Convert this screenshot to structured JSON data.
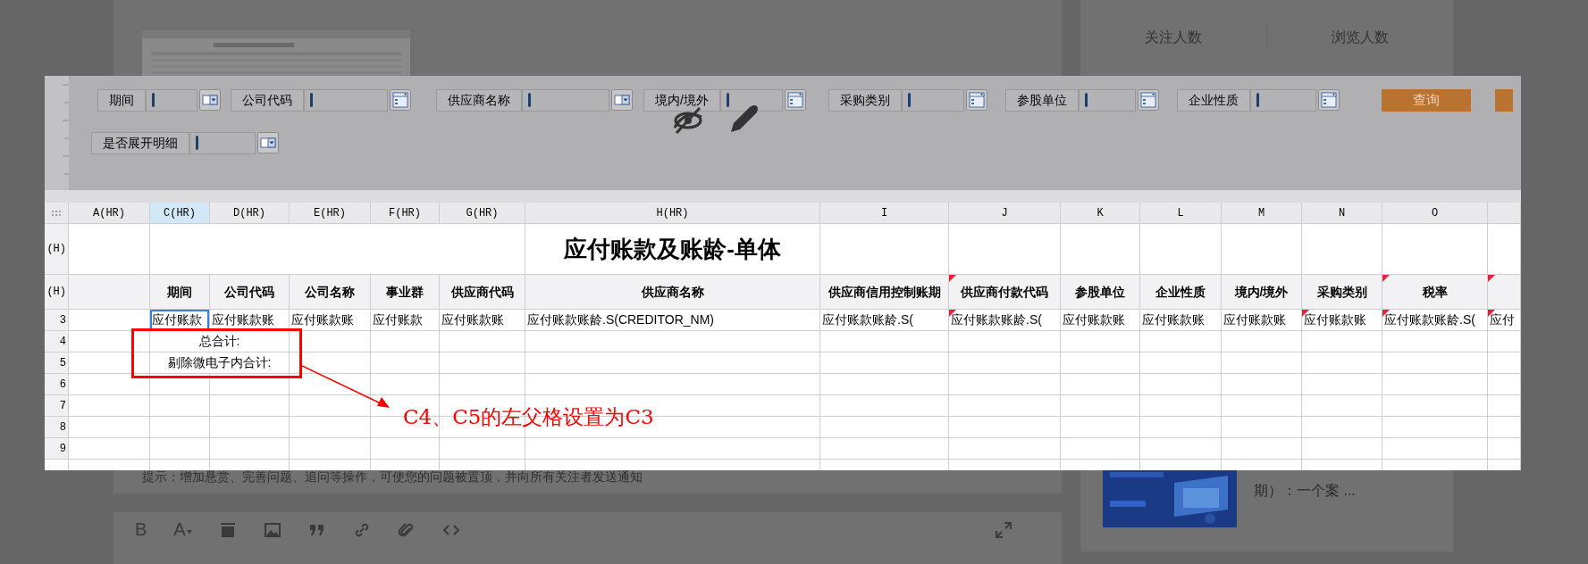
{
  "background_page": {
    "stats": [
      {
        "label": "关注人数"
      },
      {
        "label": "浏览人数"
      }
    ],
    "hint": "提示：增加悬赏、完善问题、追问等操作，可使您的问题被置顶，并向所有关注者发送通知",
    "editor_toolbar": {
      "bold_glyph": "B",
      "font_glyph": "A"
    },
    "side_article": {
      "title_fragment": "期）：一个案 ..."
    }
  },
  "image": {
    "filter_rows": [
      [
        {
          "label": "期间",
          "kind": "dropdown"
        },
        {
          "label": "公司代码",
          "kind": "list"
        },
        {
          "label": "供应商名称",
          "kind": "dropdown"
        },
        {
          "label": "境内/境外",
          "kind": "list"
        },
        {
          "label": "采购类别",
          "kind": "list"
        },
        {
          "label": "参股单位",
          "kind": "list"
        },
        {
          "label": "企业性质",
          "kind": "list"
        }
      ],
      [
        {
          "label": "是否展开明细",
          "kind": "dropdown"
        }
      ]
    ],
    "buttons": [
      "查询"
    ],
    "sheet": {
      "columns": [
        {
          "header": "A(HR)",
          "selected": false
        },
        {
          "header": "C(HR)",
          "selected": true
        },
        {
          "header": "D(HR)",
          "selected": false
        },
        {
          "header": "E(HR)",
          "selected": false
        },
        {
          "header": "F(HR)",
          "selected": false
        },
        {
          "header": "G(HR)",
          "selected": false
        },
        {
          "header": "H(HR)",
          "selected": false
        },
        {
          "header": "I",
          "selected": false
        },
        {
          "header": "J",
          "selected": false
        },
        {
          "header": "K",
          "selected": false
        },
        {
          "header": "L",
          "selected": false
        },
        {
          "header": "M",
          "selected": false
        },
        {
          "header": "N",
          "selected": false
        },
        {
          "header": "O",
          "selected": false
        },
        {
          "selected": false
        }
      ],
      "rows": [
        {
          "kind": "title",
          "header": "(H)",
          "title": "应付账款及账龄-单体"
        },
        {
          "kind": "headings",
          "header": "(H)",
          "cells": [
            {
              "marked": false
            },
            {
              "text": "期间",
              "marked": false
            },
            {
              "text": "公司代码",
              "marked": false
            },
            {
              "text": "公司名称",
              "marked": false
            },
            {
              "text": "事业群",
              "marked": false
            },
            {
              "text": "供应商代码",
              "marked": false
            },
            {
              "text": "供应商名称",
              "marked": false
            },
            {
              "text": "供应商信用控制账期",
              "marked": false
            },
            {
              "text": "供应商付款代码",
              "marked": true
            },
            {
              "text": "参股单位",
              "marked": false
            },
            {
              "text": "企业性质",
              "marked": false
            },
            {
              "text": "境内/境外",
              "marked": false
            },
            {
              "text": "采购类别",
              "marked": false
            },
            {
              "text": "税率",
              "marked": true
            },
            {
              "marked": true
            }
          ]
        },
        {
          "kind": "data",
          "header": "3",
          "cells": [
            {
              "marked": false,
              "selected": false
            },
            {
              "text": "应付账款",
              "marked": false,
              "selected": true
            },
            {
              "text": "应付账款账",
              "marked": false,
              "selected": false
            },
            {
              "text": "应付账款账",
              "marked": false,
              "selected": false
            },
            {
              "text": "应付账款",
              "marked": false,
              "selected": false
            },
            {
              "text": "应付账款账",
              "marked": false,
              "selected": false
            },
            {
              "text": "应付账款账龄.S(CREDITOR_NM)",
              "marked": false,
              "selected": false
            },
            {
              "text": "应付账款账龄.S(",
              "marked": false,
              "selected": false
            },
            {
              "text": "应付账款账龄.S(",
              "marked": true,
              "selected": false
            },
            {
              "text": "应付账款账",
              "marked": false,
              "selected": false
            },
            {
              "text": "应付账款账",
              "marked": false,
              "selected": false
            },
            {
              "text": "应付账款账",
              "marked": false,
              "selected": false
            },
            {
              "text": "应付账款账",
              "marked": true,
              "selected": false
            },
            {
              "text": "应付账款账龄.S(",
              "marked": true,
              "selected": false
            },
            {
              "text": "应付",
              "marked": true,
              "selected": false
            }
          ]
        },
        {
          "kind": "total",
          "header": "4",
          "label": "总合计:"
        },
        {
          "kind": "total",
          "header": "5",
          "label": "剔除微电子内合计:"
        },
        {
          "kind": "blank",
          "header": "6"
        },
        {
          "kind": "blank",
          "header": "7"
        },
        {
          "kind": "blank",
          "header": "8"
        },
        {
          "kind": "blank",
          "header": "9"
        }
      ],
      "annotation": {
        "text": "C4、C5的左父格设置为C3"
      }
    }
  }
}
